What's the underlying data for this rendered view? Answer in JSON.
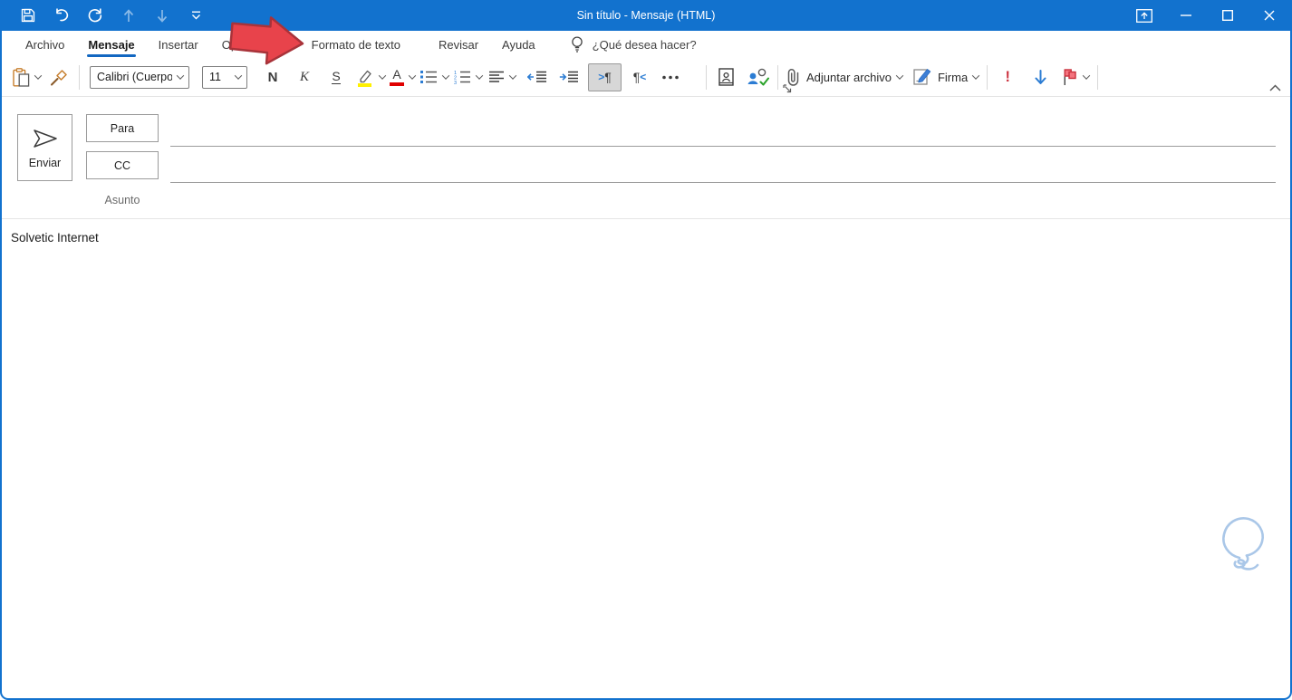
{
  "window": {
    "title": "Sin título  -  Mensaje (HTML)"
  },
  "tabs": {
    "items": [
      {
        "label": "Archivo"
      },
      {
        "label": "Mensaje",
        "active": true
      },
      {
        "label": "Insertar"
      },
      {
        "label": "Opciones"
      },
      {
        "label": "Formato de texto"
      },
      {
        "label": "Revisar"
      },
      {
        "label": "Ayuda"
      }
    ],
    "tell_me": "¿Qué desea hacer?"
  },
  "ribbon": {
    "font_name": "Calibri (Cuerpo",
    "font_size": "11",
    "bold": "N",
    "italic": "K",
    "underline": "S",
    "font_color_letter": "A",
    "attach": "Adjuntar archivo",
    "signature": "Firma"
  },
  "compose": {
    "send": "Enviar",
    "to": "Para",
    "cc": "CC",
    "subject": "Asunto",
    "to_value": "",
    "cc_value": "",
    "subject_value": "",
    "body": "Solvetic Internet"
  },
  "colors": {
    "titlebar_blue": "#1272CE",
    "accent_blue": "#1267C1",
    "icon_blue": "#2B7CD3",
    "highlight_yellow": "#FFF000",
    "font_red": "#E00000",
    "importance_red": "#CE3B47",
    "flag_red": "#F4737E",
    "arrow_red": "#E8434B",
    "watermark_blue": "#AAC7E8"
  }
}
